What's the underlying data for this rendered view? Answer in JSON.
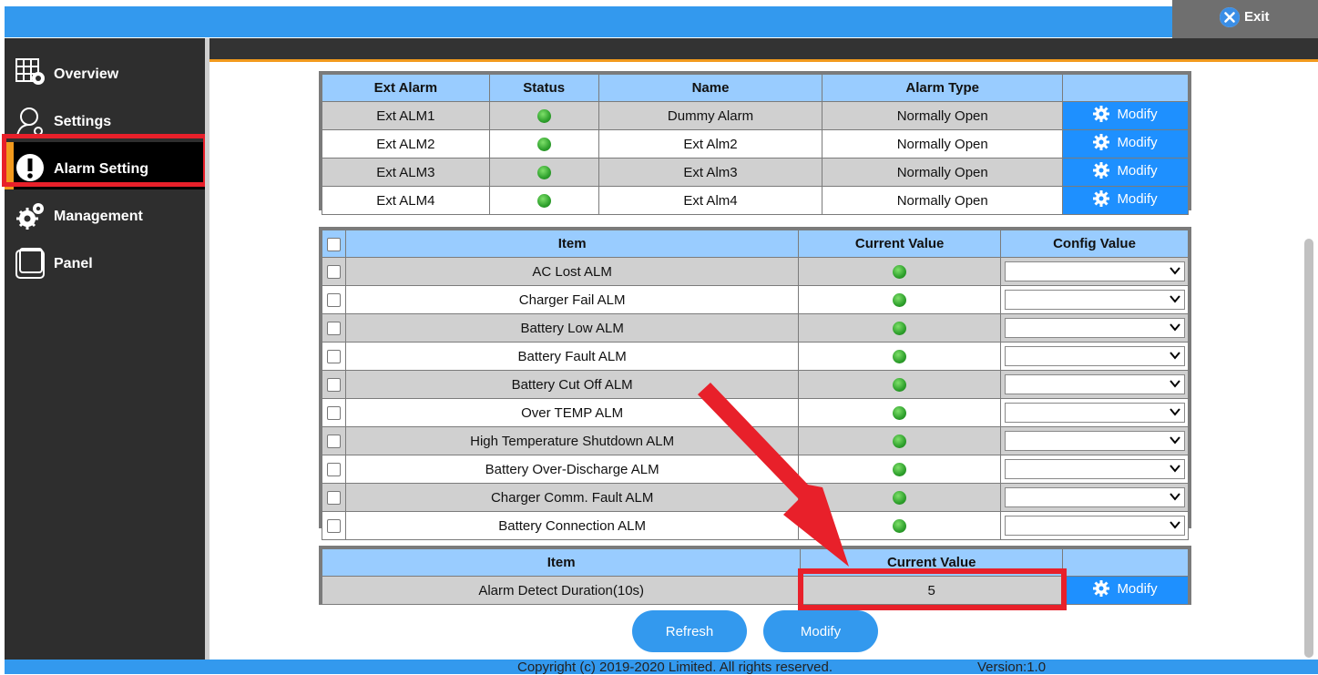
{
  "header": {
    "exit_label": "Exit"
  },
  "sidebar": {
    "items": [
      {
        "label": "Overview",
        "icon": "overview-icon"
      },
      {
        "label": "Settings",
        "icon": "user-settings-icon"
      },
      {
        "label": "Alarm Setting",
        "icon": "alert-icon",
        "active": true
      },
      {
        "label": "Management",
        "icon": "gears-icon"
      },
      {
        "label": "Panel",
        "icon": "panel-icon"
      }
    ]
  },
  "ext_alarm_table": {
    "headers": [
      "Ext Alarm",
      "Status",
      "Name",
      "Alarm Type",
      ""
    ],
    "modify_label": "Modify",
    "rows": [
      {
        "id": "Ext ALM1",
        "status": "ok",
        "name": "Dummy Alarm",
        "type": "Normally Open"
      },
      {
        "id": "Ext ALM2",
        "status": "ok",
        "name": "Ext Alm2",
        "type": "Normally Open"
      },
      {
        "id": "Ext ALM3",
        "status": "ok",
        "name": "Ext Alm3",
        "type": "Normally Open"
      },
      {
        "id": "Ext ALM4",
        "status": "ok",
        "name": "Ext Alm4",
        "type": "Normally Open"
      }
    ]
  },
  "item_table": {
    "headers": [
      "Item",
      "Current Value",
      "Config Value"
    ],
    "rows": [
      {
        "item": "AC Lost ALM",
        "current": "ok",
        "config": ""
      },
      {
        "item": "Charger Fail ALM",
        "current": "ok",
        "config": ""
      },
      {
        "item": "Battery Low ALM",
        "current": "ok",
        "config": ""
      },
      {
        "item": "Battery Fault ALM",
        "current": "ok",
        "config": ""
      },
      {
        "item": "Battery Cut Off ALM",
        "current": "ok",
        "config": ""
      },
      {
        "item": "Over TEMP ALM",
        "current": "ok",
        "config": ""
      },
      {
        "item": "High Temperature Shutdown ALM",
        "current": "ok",
        "config": ""
      },
      {
        "item": "Battery Over-Discharge ALM",
        "current": "ok",
        "config": ""
      },
      {
        "item": "Charger Comm. Fault ALM",
        "current": "ok",
        "config": ""
      },
      {
        "item": "Battery Connection ALM",
        "current": "ok",
        "config": ""
      }
    ]
  },
  "duration_table": {
    "headers": [
      "Item",
      "Current Value",
      ""
    ],
    "item": "Alarm Detect Duration(10s)",
    "value": "5",
    "modify_label": "Modify"
  },
  "actions": {
    "refresh_label": "Refresh",
    "modify_label": "Modify"
  },
  "footer": {
    "copyright": "Copyright (c) 2019-2020 Limited. All rights reserved.",
    "version": "Version:1.0"
  },
  "colors": {
    "topbar": "#3399ee",
    "sidebar": "#2e2e2e",
    "table_header": "#99ccff",
    "modify_button": "#1e90ff",
    "highlight": "#e8202a",
    "accent": "#f29a1d"
  }
}
